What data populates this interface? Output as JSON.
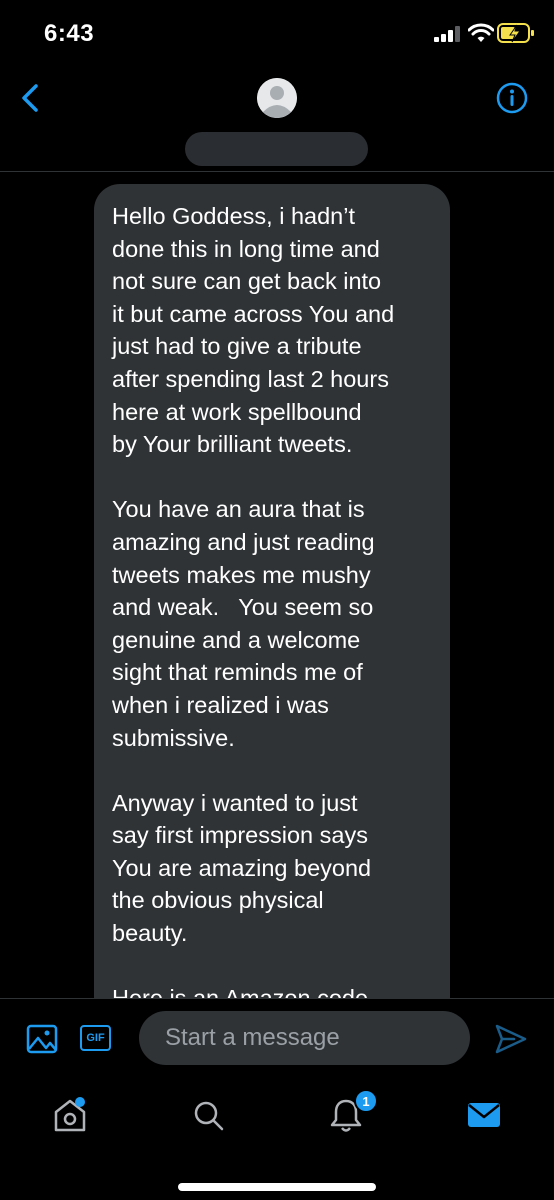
{
  "status_bar": {
    "time": "6:43"
  },
  "header": {
    "back_icon": "chevron-left-icon",
    "avatar_icon": "default-avatar-icon",
    "info_icon": "info-icon"
  },
  "message": {
    "paragraphs": [
      "Hello Goddess, i hadn’t\ndone this in long time and\nnot sure can get back into\nit but came across You and\njust had to give a tribute\nafter spending last 2 hours\nhere at work spellbound\nby Your brilliant tweets.",
      "You have an aura that is\namazing and just reading\ntweets makes me mushy\nand weak.   You seem so\ngenuine and a welcome\nsight that reminds me of\nwhen i realized i was\nsubmissive.",
      "Anyway i wanted to just\nsay first impression says\nYou are amazing beyond\nthe obvious physical\nbeauty.",
      "Here is an Amazon code"
    ]
  },
  "composer": {
    "gif_label": "GIF",
    "placeholder": "Start a message"
  },
  "tab_bar": {
    "notifications_badge": "1"
  },
  "colors": {
    "accent": "#1d9bf0",
    "background": "#000000",
    "bubble": "#2f3336"
  }
}
